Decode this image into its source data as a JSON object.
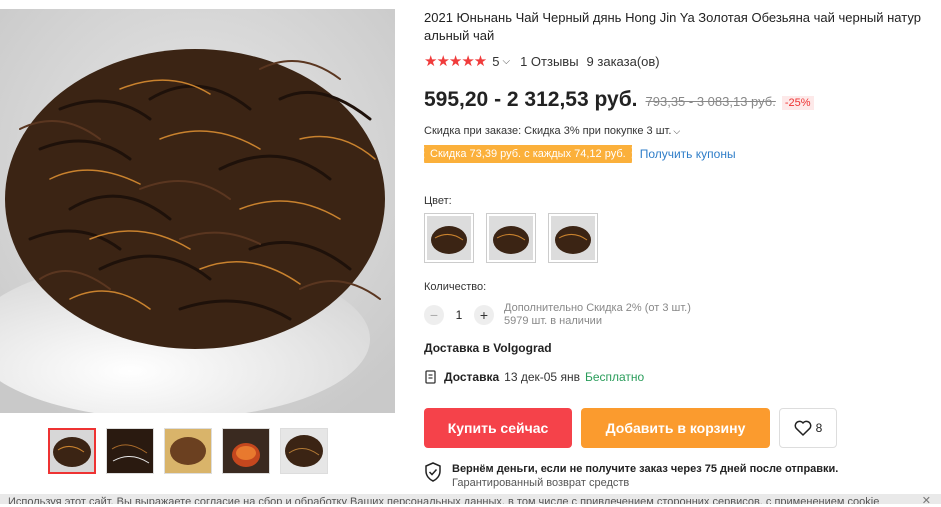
{
  "product": {
    "title": "2021 Юньнань Чай Черный дянь Hong Jin Ya Золотая Обезьяна чай черный натур альный чай",
    "rating_value": "5",
    "reviews": "1 Отзывы",
    "orders": "9 заказа(ов)",
    "price": "595,20 - 2 312,53 руб.",
    "old_price": "793,35 - 3 083,13 руб.",
    "discount": "-25%",
    "bulk_discount": "Скидка при заказе: Скидка 3% при покупке 3 шт.",
    "coupon": "Скидка 73,39 руб. с каждых 74,12 руб.",
    "coupon_link": "Получить купоны"
  },
  "options": {
    "color_label": "Цвет:",
    "quantity_label": "Количество:",
    "quantity_value": "1",
    "quantity_minus": "−",
    "quantity_plus": "+",
    "extra_discount": "Дополнительно Скидка 2% (от 3 шт.)",
    "stock": "5979 шт. в наличии"
  },
  "delivery": {
    "to": "Доставка в Volgograd",
    "label": "Доставка",
    "dates": "13 дек-05 янв",
    "cost": "Бесплатно"
  },
  "actions": {
    "buy_now": "Купить сейчас",
    "add_to_cart": "Добавить в корзину",
    "wishlist_count": "8"
  },
  "guarantee": {
    "line1": "Вернём деньги, если не получите заказ через 75 дней после отправки.",
    "line2": "Гарантированный возврат средств"
  },
  "cookie": {
    "text": "Используя этот сайт, Вы выражаете согласие на сбор и обработку Ваших персональных данных, в том числе с привлечением сторонних сервисов, с применением cookie"
  },
  "colors": {
    "accent": "#f5424a",
    "cart": "#fb9b2e",
    "coupon": "#fbb03b",
    "link": "#2e7dc8",
    "free": "#2a9d5b"
  },
  "icons": {
    "rating": "star-icon",
    "delivery": "document-icon",
    "wishlist": "heart-icon",
    "guarantee": "shield-check-icon"
  }
}
